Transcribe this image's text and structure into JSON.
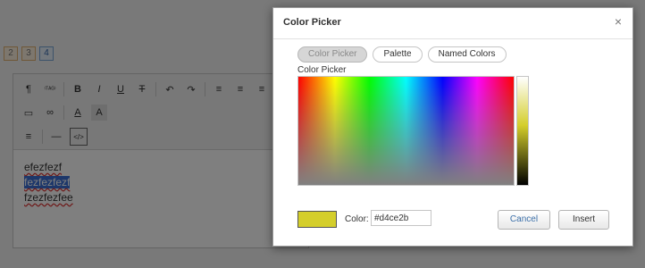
{
  "pager": {
    "items": [
      "2",
      "3",
      "4"
    ],
    "active": "4"
  },
  "toolbar": {
    "row1": [
      "¶",
      "⁽ᵀᴬᴳ⁾",
      "B",
      "I",
      "U",
      "T",
      "↶",
      "↷",
      "≡",
      "≡",
      "≡",
      "≡"
    ],
    "row2": [
      "▭",
      "∞",
      "A",
      "A"
    ],
    "row3": [
      "≡",
      "—",
      "</>"
    ]
  },
  "editor": {
    "lines": [
      "efezfezf",
      "fezfezfezf",
      "fzezfezfee"
    ]
  },
  "dialog": {
    "title": "Color Picker",
    "close_glyph": "×",
    "tabs": [
      {
        "label": "Color Picker",
        "active": true
      },
      {
        "label": "Palette",
        "active": false
      },
      {
        "label": "Named Colors",
        "active": false
      }
    ],
    "picker_label": "Color Picker",
    "selected_color": "#d4ce2b",
    "color_label": "Color:",
    "color_value": "#d4ce2b",
    "cancel_label": "Cancel",
    "insert_label": "Insert"
  }
}
